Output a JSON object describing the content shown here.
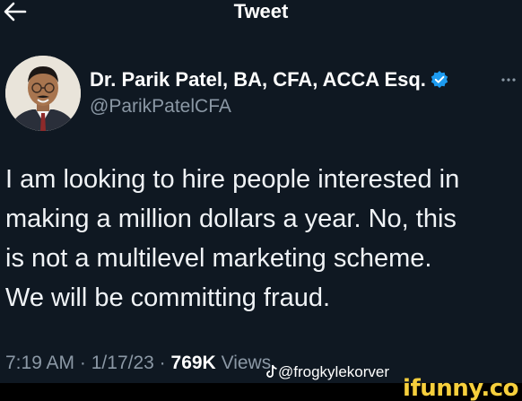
{
  "header": {
    "title": "Tweet",
    "back_icon": "arrow-left-icon"
  },
  "author": {
    "name": "Dr. Parik Patel, BA, CFA, ACCA Esq.",
    "handle": "@ParikPatelCFA",
    "verified": true,
    "verified_color": "#1d9bf0",
    "more_icon": "ellipsis-icon"
  },
  "tweet": {
    "lines": [
      "I am looking to hire people interested in",
      "making a million dollars a year. No, this",
      "is not a multilevel marketing scheme.",
      "We will be committing fraud."
    ]
  },
  "meta": {
    "time": "7:19 AM",
    "separator": "·",
    "date": "1/17/23",
    "views_count": "769K",
    "views_label": "Views"
  },
  "watermark": {
    "icon": "tiktok-icon",
    "text": "@frogkylekorver"
  },
  "branding": {
    "logo_text": "ifunny.co",
    "logo_color": "#f6cf3c"
  },
  "colors": {
    "background": "#0f1822",
    "secondary_text": "#8b98a5",
    "primary_text": "#ffffff"
  }
}
